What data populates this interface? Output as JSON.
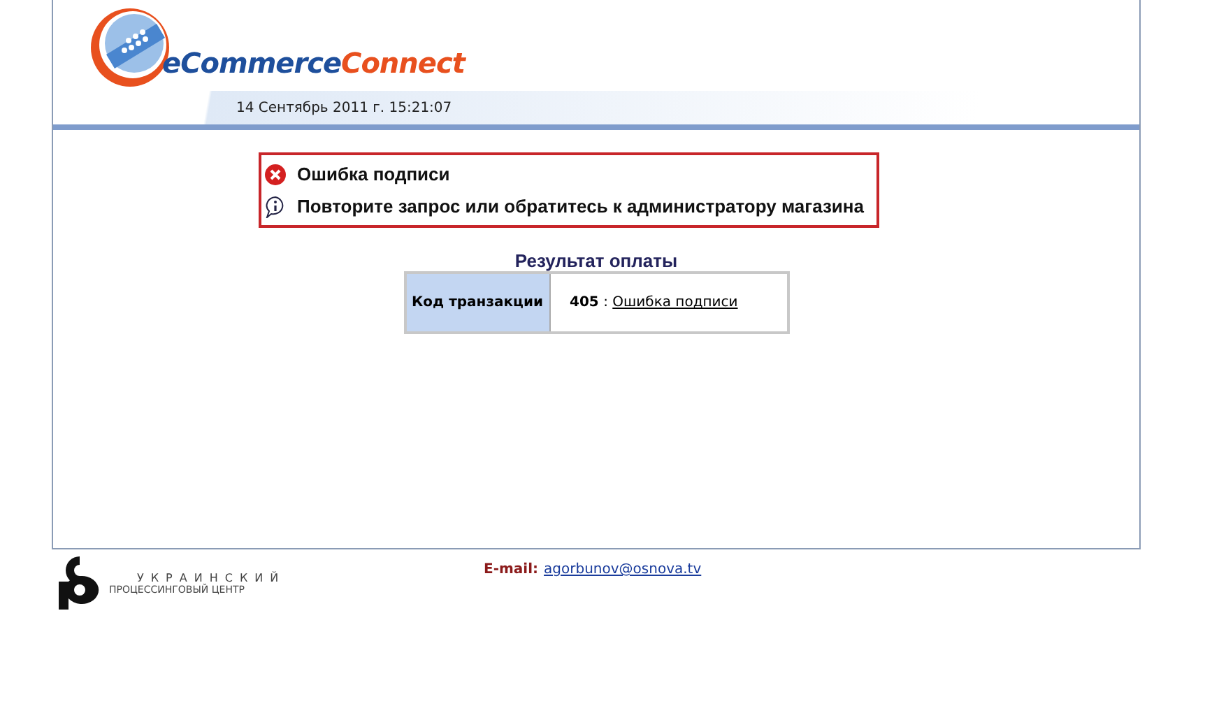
{
  "header": {
    "logo_words": [
      "eCommerce",
      "Connect"
    ],
    "datetime": "14 Сентябрь 2011 г. 15:21:07"
  },
  "messages": [
    {
      "kind": "error",
      "text": "Ошибка подписи"
    },
    {
      "kind": "info",
      "text": "Повторите запрос или обратитесь к администратору магазина"
    }
  ],
  "result": {
    "title": "Результат оплаты",
    "label": "Код транзакции",
    "code": "405",
    "separator": ":",
    "link": "Ошибка подписи"
  },
  "footer": {
    "org_line_1": "УКРАИНСКИЙ",
    "org_line_2": "ПРОЦЕССИНГОВЫЙ ЦЕНТР",
    "email_label": "E-mail:",
    "email": "agorbunov@osnova.tv"
  }
}
